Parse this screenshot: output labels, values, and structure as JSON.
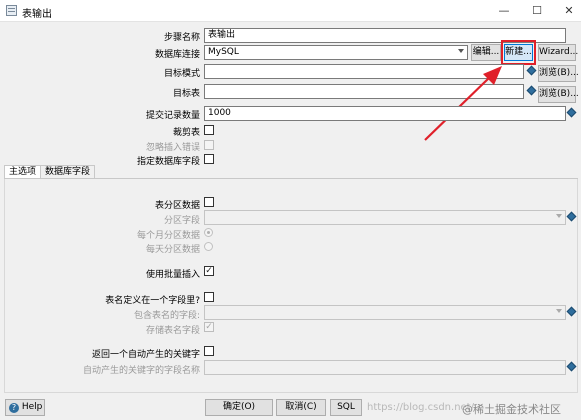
{
  "window": {
    "title": "表输出",
    "minimize": "—",
    "maximize": "☐",
    "close": "✕"
  },
  "form": {
    "step_name_label": "步骤名称",
    "step_name_value": "表输出",
    "db_conn_label": "数据库连接",
    "db_conn_value": "MySQL",
    "edit_button": "编辑...",
    "new_button": "新建...",
    "wizard_button": "Wizard...",
    "target_schema_label": "目标模式",
    "target_schema_value": "",
    "browse_button_1": "浏览(B)...",
    "target_table_label": "目标表",
    "target_table_value": "",
    "browse_button_2": "浏览(B)...",
    "commit_size_label": "提交记录数量",
    "commit_size_value": "1000",
    "truncate_label": "裁剪表",
    "ignore_errors_label": "忽略插入错误",
    "specify_fields_label": "指定数据库字段"
  },
  "tabs": [
    {
      "label": "主选项"
    },
    {
      "label": "数据库字段"
    }
  ],
  "main": {
    "partition_label": "表分区数据",
    "partition_field_label": "分区字段",
    "monthly_label": "每个月分区数据",
    "daily_label": "每天分区数据",
    "batch_label": "使用批量插入",
    "batch_check": "✓",
    "tablename_in_field_label": "表名定义在一个字段里?",
    "tablename_field_label": "包含表名的字段:",
    "store_tablename_label": "存储表名字段",
    "store_tablename_check": "✓",
    "return_key_label": "返回一个自动产生的关键字",
    "auto_key_field_label": "自动产生的关键字的字段名称"
  },
  "footer": {
    "help_button": "Help",
    "help_icon": "?",
    "ok_button": "确定(O)",
    "cancel_button": "取消(C)",
    "sql_button": "SQL",
    "watermark_url": "https://blog.csdn.net/",
    "watermark_site": "@稀土掘金技术社区"
  },
  "colors": {
    "highlight_red": "#e0202a",
    "accent_blue": "#0078d7"
  }
}
